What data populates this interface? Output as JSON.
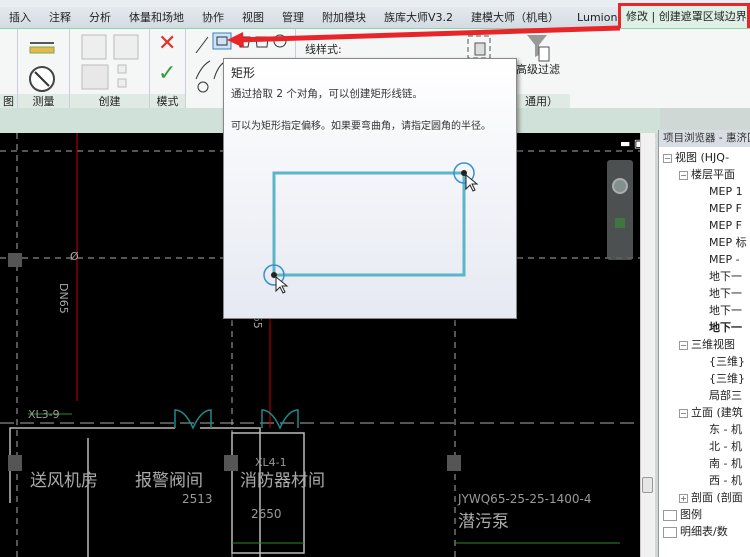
{
  "ribbon_tabs": [
    "插入",
    "注释",
    "分析",
    "体量和场地",
    "协作",
    "视图",
    "管理",
    "附加模块",
    "族库大师V3.2",
    "建模大师（机电）",
    "Lumion®"
  ],
  "active_tab": "修改 | 创建遮罩区域边界",
  "panels": {
    "left_partial": "图",
    "measure": "测量",
    "create": "创建",
    "mode": "模式",
    "filter": "通用）"
  },
  "line_style_label": "线样式:",
  "advanced_filter": "高级过滤",
  "tooltip": {
    "title": "矩形",
    "line1": "通过拾取 2 个对角，可以创建矩形线链。",
    "line2": "可以为矩形指定偏移。如果要弯曲角，请指定圆角的半径。"
  },
  "browser": {
    "title": "项目浏览器 - 惠济区",
    "items": [
      {
        "label": "视图 (HJQ-",
        "level": 0,
        "toggle": "−"
      },
      {
        "label": "楼层平面",
        "level": 1,
        "toggle": "−"
      },
      {
        "label": "MEP 1",
        "level": 2
      },
      {
        "label": "MEP F",
        "level": 2
      },
      {
        "label": "MEP F",
        "level": 2
      },
      {
        "label": "MEP 标",
        "level": 2
      },
      {
        "label": "MEP -",
        "level": 2
      },
      {
        "label": "地下一",
        "level": 2
      },
      {
        "label": "地下一",
        "level": 2
      },
      {
        "label": "地下一",
        "level": 2
      },
      {
        "label": "地下一",
        "level": 2,
        "bold": true
      },
      {
        "label": "三维视图",
        "level": 1,
        "toggle": "−"
      },
      {
        "label": "{三维}",
        "level": 2
      },
      {
        "label": "{三维}",
        "level": 2
      },
      {
        "label": "局部三",
        "level": 2
      },
      {
        "label": "立面 (建筑",
        "level": 1,
        "toggle": "−"
      },
      {
        "label": "东 - 机",
        "level": 2
      },
      {
        "label": "北 - 机",
        "level": 2
      },
      {
        "label": "南 - 机",
        "level": 2
      },
      {
        "label": "西 - 机",
        "level": 2
      },
      {
        "label": "剖面 (剖面",
        "level": 1,
        "toggle": "+"
      },
      {
        "label": "图例",
        "level": 0,
        "icon": true
      },
      {
        "label": "明细表/数",
        "level": 0,
        "icon": true
      }
    ]
  },
  "drawing": {
    "labels": [
      "DN65",
      "DN65",
      "XL3-9",
      "XL4-1",
      "送风机房",
      "报警阀间",
      "消防器材间",
      "2513",
      "2650",
      "JYWQ65-25-25-1400-4",
      "潜污泵",
      "Ø",
      "Ø"
    ]
  },
  "colors": {
    "highlight": "#e8262a",
    "rect_stroke": "#5bb5c8",
    "canvas": "#000000"
  }
}
